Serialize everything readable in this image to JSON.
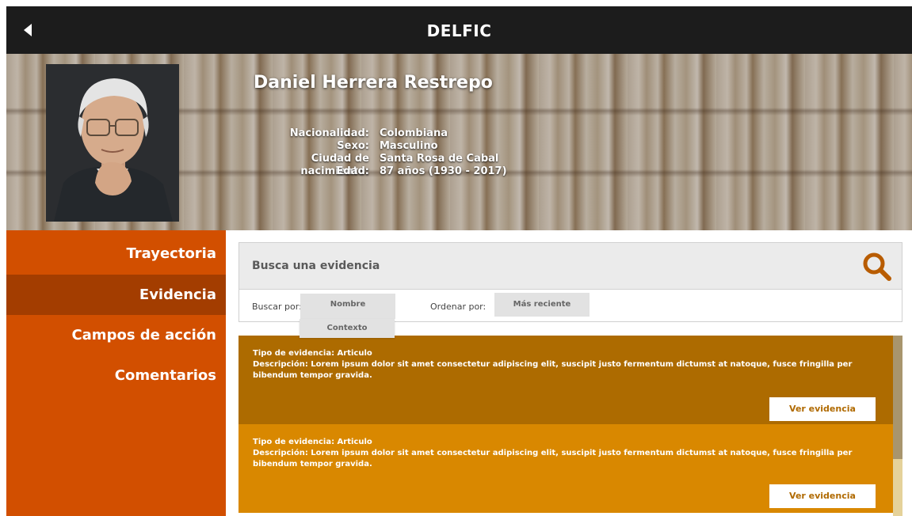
{
  "header": {
    "title": "DELFIC",
    "back_icon": "back-arrow-icon"
  },
  "profile": {
    "name": "Daniel Herrera Restrepo",
    "fields": [
      {
        "label": "Nacionalidad:",
        "value": "Colombiana"
      },
      {
        "label": "Sexo:",
        "value": "Masculino"
      },
      {
        "label": "Ciudad de nacimiento:",
        "value": "Santa Rosa de Cabal"
      },
      {
        "label": "Edad:",
        "value": "87 años (1930 - 2017)"
      }
    ]
  },
  "sidebar": {
    "items": [
      {
        "label": "Trayectoria",
        "active": false
      },
      {
        "label": "Evidencia",
        "active": true
      },
      {
        "label": "Campos de acción",
        "active": false
      },
      {
        "label": "Comentarios",
        "active": false
      }
    ]
  },
  "search": {
    "placeholder": "Busca una evidencia",
    "search_by_label": "Buscar por:",
    "search_by_options": [
      "Nombre",
      "Contexto"
    ],
    "sort_by_label": "Ordenar por:",
    "sort_by_value": "Más reciente"
  },
  "evidences": [
    {
      "type": "Tipo de evidencia: Articulo",
      "description": "Descripción: Lorem ipsum dolor sit amet consectetur adipiscing elit, suscipit justo fermentum dictumst at natoque, fusce fringilla per bibendum tempor gravida.",
      "button_label": "Ver evidencia"
    },
    {
      "type": "Tipo de evidencia: Articulo",
      "description": "Descripción: Lorem ipsum dolor sit amet consectetur adipiscing elit, suscipit justo fermentum dictumst at natoque, fusce fringilla per bibendum tempor gravida.",
      "button_label": "Ver evidencia"
    }
  ],
  "colors": {
    "topbar": "#1c1c1c",
    "sidebar": "#d24f00",
    "sidebar_active": "#a33d00",
    "card_dark": "#ad6b00",
    "card_light": "#d98800",
    "accent": "#b06a00"
  }
}
